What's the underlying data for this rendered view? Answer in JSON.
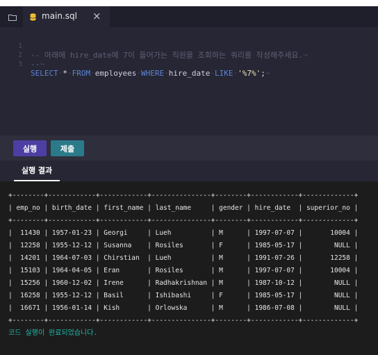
{
  "editor": {
    "tab": {
      "filename": "main.sql",
      "close_symbol": "×",
      "file_icon": "database-icon"
    },
    "folder_icon": "folder-icon",
    "lines": [
      {
        "number": "1",
        "comment": "-- 아래에 hire_date에 7이 들어가는 직원을 조회하는 쿼리를 작성해주세요."
      },
      {
        "number": "2",
        "comment": "--"
      },
      {
        "number": "3",
        "kw_select": "SELECT",
        "star": "*",
        "kw_from": "FROM",
        "table": "employees",
        "kw_where": "WHERE",
        "column": "hire_date",
        "kw_like": "LIKE",
        "pattern": "'%7%'",
        "semicolon": ";"
      }
    ]
  },
  "actions": {
    "run_label": "실행",
    "submit_label": "제출"
  },
  "results": {
    "tab_label": "실행 결과",
    "columns": [
      "emp_no",
      "birth_date",
      "first_name",
      "last_name",
      "gender",
      "hire_date",
      "superior_no"
    ],
    "rows": [
      [
        "11430",
        "1957-01-23",
        "Georgi",
        "Lueh",
        "M",
        "1997-07-07",
        "10004"
      ],
      [
        "12258",
        "1955-12-12",
        "Susanna",
        "Rosiles",
        "F",
        "1985-05-17",
        "NULL"
      ],
      [
        "14201",
        "1964-07-03",
        "Chirstian",
        "Lueh",
        "M",
        "1991-07-26",
        "12258"
      ],
      [
        "15103",
        "1964-04-05",
        "Eran",
        "Rosiles",
        "M",
        "1997-07-07",
        "10004"
      ],
      [
        "15256",
        "1960-12-02",
        "Irene",
        "Radhakrishnan",
        "M",
        "1987-10-12",
        "NULL"
      ],
      [
        "16258",
        "1955-12-12",
        "Basil",
        "Ishibashi",
        "F",
        "1985-05-17",
        "NULL"
      ],
      [
        "16671",
        "1956-01-14",
        "Kish",
        "Orlowska",
        "M",
        "1986-07-08",
        "NULL"
      ]
    ],
    "status": "코드 실행이 완료되었습니다."
  },
  "colors": {
    "accent_run": "#4c3fa3",
    "accent_submit": "#2b7a8a",
    "status_text": "#20b7a7",
    "editor_bg": "#262634",
    "console_bg": "#1c1c1c"
  }
}
